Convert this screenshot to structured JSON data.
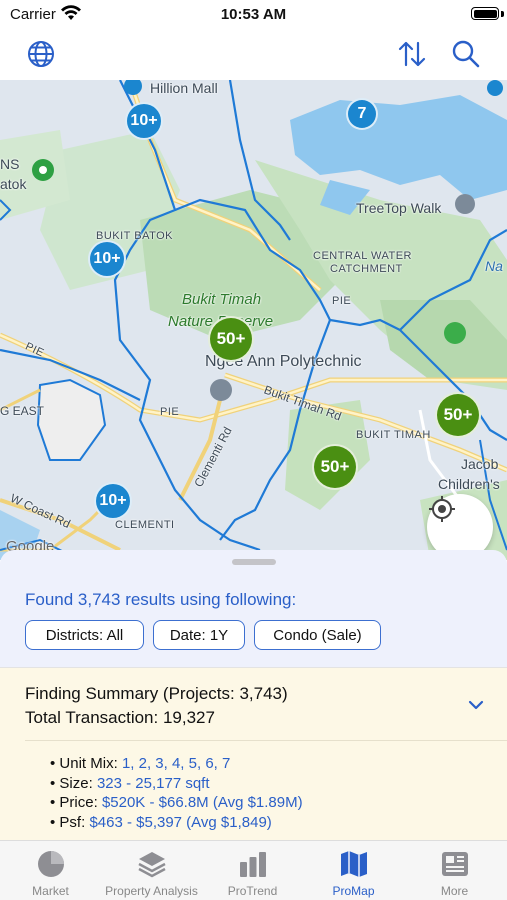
{
  "status": {
    "carrier": "Carrier",
    "time": "10:53 AM"
  },
  "nav": {
    "globe_icon": "globe-icon",
    "sort_icon": "sort-arrows-icon",
    "search_icon": "search-icon"
  },
  "map": {
    "labels": {
      "hillion": "Hillion Mall",
      "ns": "NS",
      "batok": "atok",
      "bukit_batok": "BUKIT BATOK",
      "treetop": "TreeTop Walk",
      "central_water": "CENTRAL WATER",
      "catchment": "CATCHMENT",
      "na": "Na",
      "bukit_timah_nature_1": "Bukit Timah",
      "bukit_timah_nature_2": "Nature Reserve",
      "pie1": "PIE",
      "pie2": "PIE",
      "pie3": "PIE",
      "ngee_ann": "Ngee Ann Polytechnic",
      "bukit_timah_rd": "Bukit Timah Rd",
      "clementi_rd": "Clementi Rd",
      "g_east": "G EAST",
      "bukit_timah": "BUKIT TIMAH",
      "jacob": "Jacob",
      "children": "Children's",
      "w_coast": "W Coast Rd",
      "clementi": "CLEMENTI",
      "google": "Google"
    },
    "clusters": [
      {
        "label": "10+",
        "color": "blue"
      },
      {
        "label": "7",
        "color": "blue"
      },
      {
        "label": "10+",
        "color": "blue"
      },
      {
        "label": "50+",
        "color": "green"
      },
      {
        "label": "50+",
        "color": "green"
      },
      {
        "label": "50+",
        "color": "green"
      },
      {
        "label": "10+",
        "color": "blue"
      }
    ]
  },
  "sheet": {
    "results_title": "Found 3,743 results using following:",
    "chips": {
      "districts": "Districts: All",
      "date": "Date: 1Y",
      "type": "Condo (Sale)"
    },
    "summary_line1": "Finding Summary (Projects: 3,743)",
    "summary_line2": "Total Transaction: 19,327",
    "unit_mix_label": "• Unit Mix: ",
    "unit_mix_values": "1, 2, 3, 4, 5, 6, 7",
    "size_label": "• Size: ",
    "size_value": "323 - 25,177 sqft",
    "price_label": "• Price: ",
    "price_value": "$520K - $66.8M (Avg $1.89M)",
    "psf_label": "• Psf: ",
    "psf_value": "$463 - $5,397 (Avg $1,849)"
  },
  "tabs": [
    {
      "label": "Market",
      "icon": "pie-chart-icon",
      "active": false
    },
    {
      "label": "Property Analysis",
      "icon": "layers-icon",
      "active": false
    },
    {
      "label": "ProTrend",
      "icon": "bar-chart-icon",
      "active": false
    },
    {
      "label": "ProMap",
      "icon": "map-icon",
      "active": true
    },
    {
      "label": "More",
      "icon": "news-icon",
      "active": false
    }
  ],
  "colors": {
    "accent": "#2a5fc8",
    "cluster_blue": "#1b86cf",
    "cluster_green": "#4a8f12",
    "summary_bg": "#fdf8e6"
  }
}
